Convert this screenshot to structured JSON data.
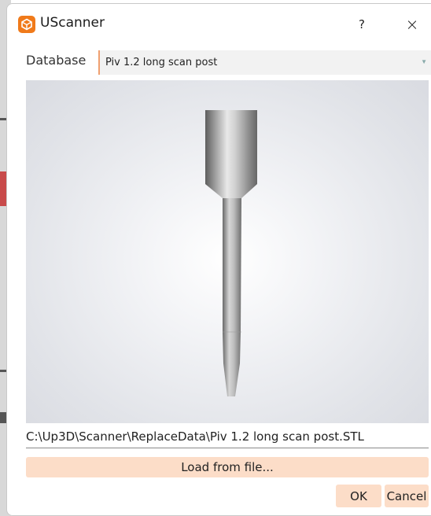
{
  "window": {
    "title": "UScanner",
    "help_label": "?",
    "close_label": "×",
    "accent_color": "#f07a1a"
  },
  "database": {
    "label": "Database",
    "selected": "Piv 1.2 long scan post"
  },
  "preview": {
    "model_name": "Piv 1.2 long scan post"
  },
  "file": {
    "path": "C:\\Up3D\\Scanner\\ReplaceData\\Piv 1.2 long scan post.STL"
  },
  "buttons": {
    "load": "Load from file...",
    "ok": "OK",
    "cancel": "Cancel",
    "button_color": "#fcddc8"
  },
  "icons": {
    "app": "uscanner-app-icon",
    "dropdown": "chevron-down-icon"
  }
}
